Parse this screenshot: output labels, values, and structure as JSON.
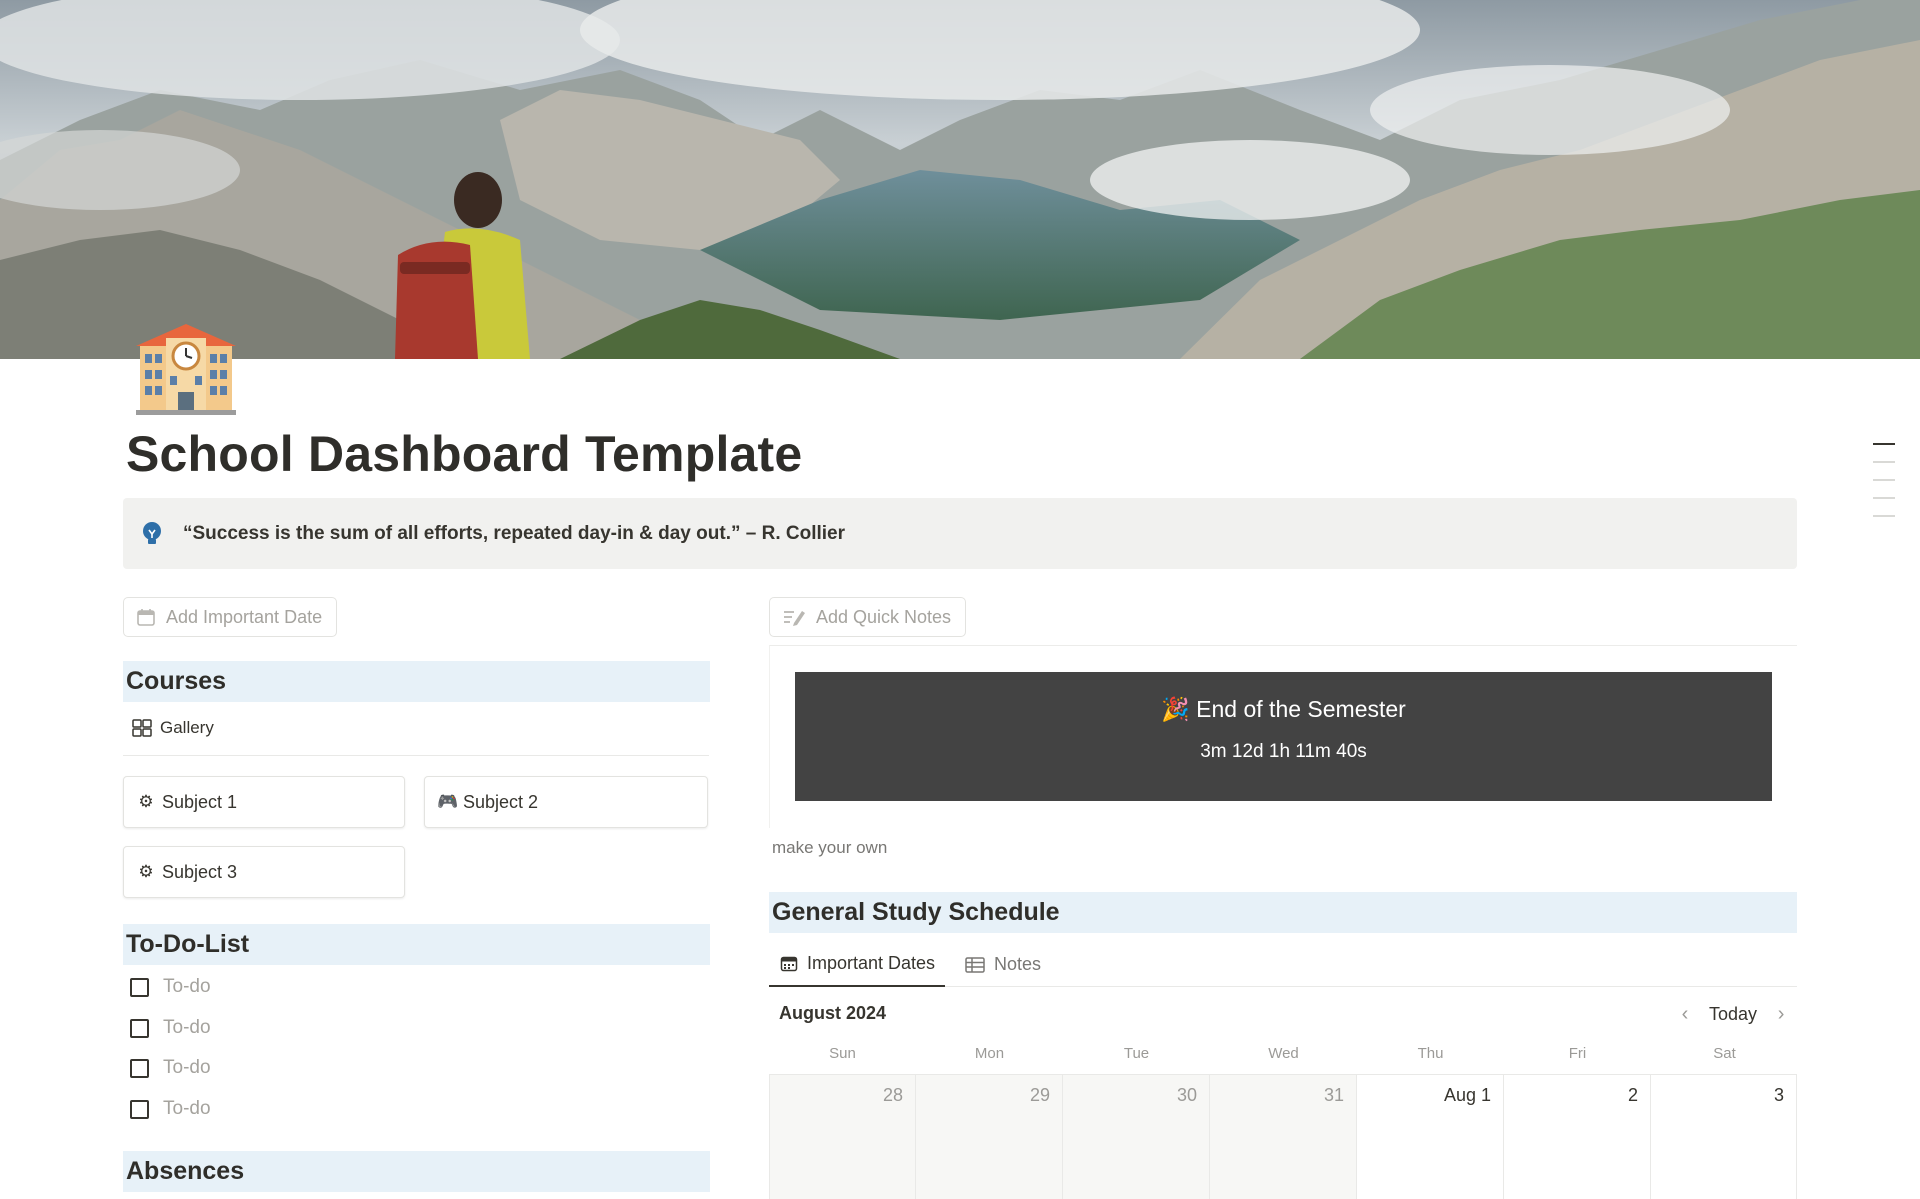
{
  "page": {
    "title": "School Dashboard Template"
  },
  "callout": {
    "text": "“Success is the sum of all efforts, repeated day-in & day out.”  –  R. Collier",
    "icon": "lightbulb-icon"
  },
  "left": {
    "add_date_label": "Add Important Date",
    "courses": {
      "heading": "Courses",
      "view_label": "Gallery",
      "cards": [
        {
          "emoji": "⚙",
          "label": "Subject 1"
        },
        {
          "emoji": "🎮",
          "label": "Subject 2"
        },
        {
          "emoji": "⚙",
          "label": "Subject 3"
        }
      ]
    },
    "todo": {
      "heading": "To-Do-List",
      "items": [
        "To-do",
        "To-do",
        "To-do",
        "To-do"
      ]
    },
    "absences": {
      "heading": "Absences"
    }
  },
  "right": {
    "add_notes_label": "Add Quick Notes",
    "countdown": {
      "title": "🎉 End of the Semester",
      "time": "3m 12d 1h 11m 40s"
    },
    "caption": "make your own",
    "schedule": {
      "heading": "General Study Schedule",
      "tabs": [
        "Important Dates",
        "Notes"
      ],
      "month": "August 2024",
      "today_label": "Today",
      "weekdays": [
        "Sun",
        "Mon",
        "Tue",
        "Wed",
        "Thu",
        "Fri",
        "Sat"
      ],
      "days": [
        "28",
        "29",
        "30",
        "31",
        "Aug 1",
        "2",
        "3"
      ]
    }
  },
  "colors": {
    "section_bg": "#e7f1f8",
    "callout_bg": "#f1f1ef",
    "countdown_bg": "#434343",
    "text": "#37352f"
  }
}
